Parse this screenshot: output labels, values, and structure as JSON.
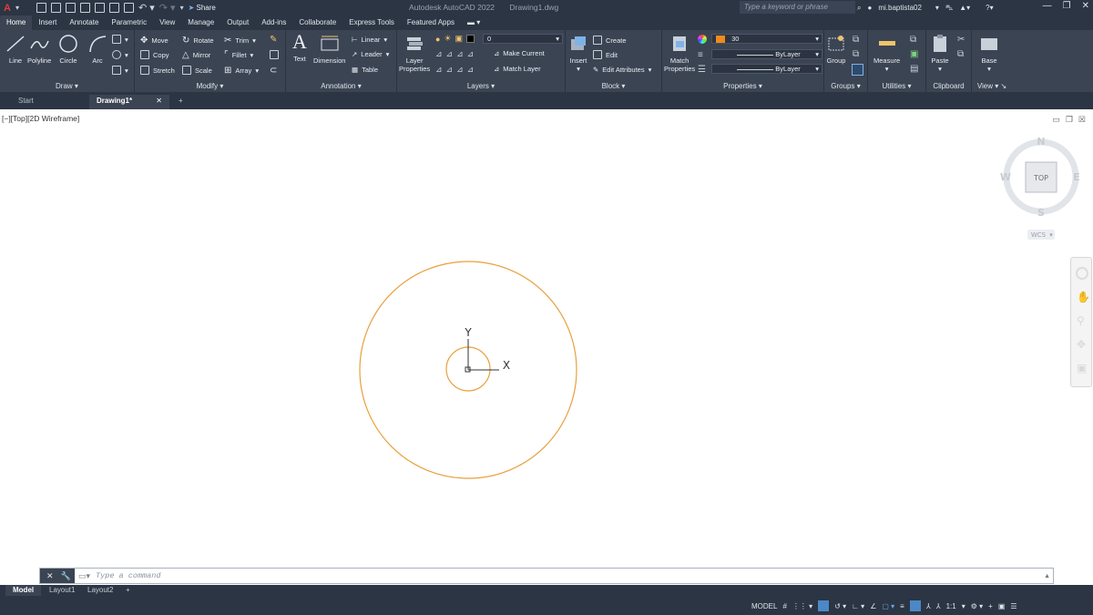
{
  "app": {
    "name": "Autodesk AutoCAD 2022",
    "file": "Drawing1.dwg"
  },
  "qat": {
    "share": "Share"
  },
  "search": {
    "placeholder": "Type a keyword or phrase"
  },
  "user": {
    "name": "mi.baptista02"
  },
  "ribbon_tabs": [
    "Home",
    "Insert",
    "Annotate",
    "Parametric",
    "View",
    "Manage",
    "Output",
    "Add-ins",
    "Collaborate",
    "Express Tools",
    "Featured Apps"
  ],
  "draw": {
    "title": "Draw",
    "line": "Line",
    "polyline": "Polyline",
    "circle": "Circle",
    "arc": "Arc"
  },
  "modify": {
    "title": "Modify",
    "move": "Move",
    "rotate": "Rotate",
    "trim": "Trim",
    "copy": "Copy",
    "mirror": "Mirror",
    "fillet": "Fillet",
    "stretch": "Stretch",
    "scale": "Scale",
    "array": "Array"
  },
  "annotation": {
    "title": "Annotation",
    "text": "Text",
    "dimension": "Dimension",
    "linear": "Linear",
    "leader": "Leader",
    "table": "Table"
  },
  "layers": {
    "title": "Layers",
    "layer_properties_1": "Layer",
    "layer_properties_2": "Properties",
    "current_layer": "0",
    "make_current": "Make Current",
    "match_layer": "Match Layer"
  },
  "block": {
    "title": "Block",
    "insert": "Insert",
    "create": "Create",
    "edit": "Edit",
    "edit_attributes": "Edit Attributes"
  },
  "properties": {
    "title": "Properties",
    "match_1": "Match",
    "match_2": "Properties",
    "color_value": "30",
    "linetype": "ByLayer",
    "lineweight": "ByLayer"
  },
  "groups": {
    "title": "Groups",
    "group": "Group"
  },
  "utilities": {
    "title": "Utilities",
    "measure": "Measure"
  },
  "clipboard": {
    "title": "Clipboard",
    "paste": "Paste"
  },
  "view": {
    "title": "View",
    "base": "Base"
  },
  "file_tabs": {
    "start": "Start",
    "drawing": "Drawing1*"
  },
  "viewport": {
    "label": "[−][Top][2D Wireframe]"
  },
  "viewcube": {
    "n": "N",
    "s": "S",
    "e": "E",
    "w": "W",
    "top": "TOP",
    "wcs": "WCS"
  },
  "ucs": {
    "x": "X",
    "y": "Y"
  },
  "command": {
    "placeholder": "Type a command"
  },
  "layout_tabs": [
    "Model",
    "Layout1",
    "Layout2"
  ],
  "status": {
    "model": "MODEL",
    "scale": "1:1"
  },
  "colors": {
    "circle": "#e8a03c",
    "ribbon_bg": "#3b4453",
    "title_bg": "#2b3543",
    "accent": "#4c88c7"
  }
}
